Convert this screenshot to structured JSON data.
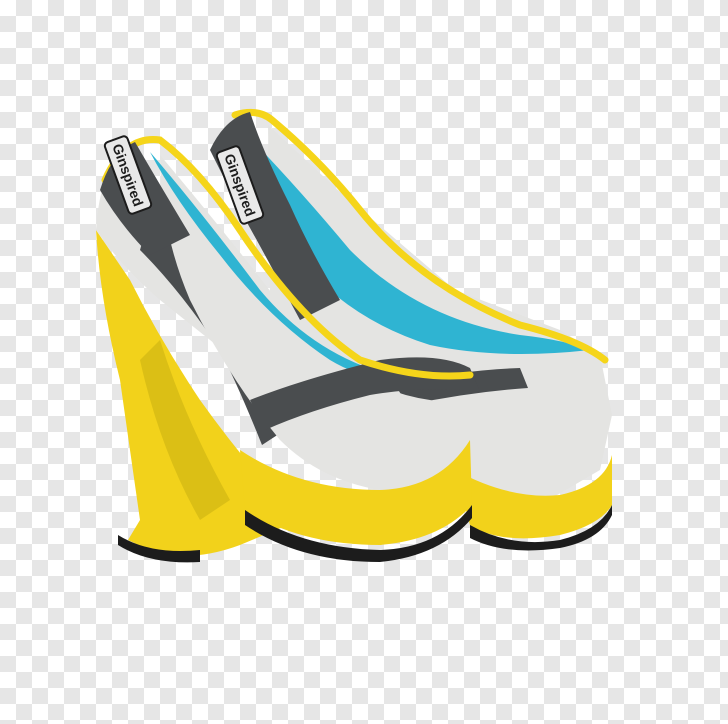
{
  "image": {
    "subject": "pair of wedge heel pumps",
    "background": "transparency-checkerboard"
  },
  "shoe": {
    "label_text": "Ginspired",
    "colors": {
      "sole_yellow": "#f2d21b",
      "sole_yellow_dark": "#c9ae10",
      "upper_white": "#e4e4e2",
      "stripe_gray": "#4a4d4f",
      "lining_blue": "#2fb4d2",
      "trim_yellow": "#f5d51a",
      "sole_black": "#1c1c1c"
    }
  }
}
